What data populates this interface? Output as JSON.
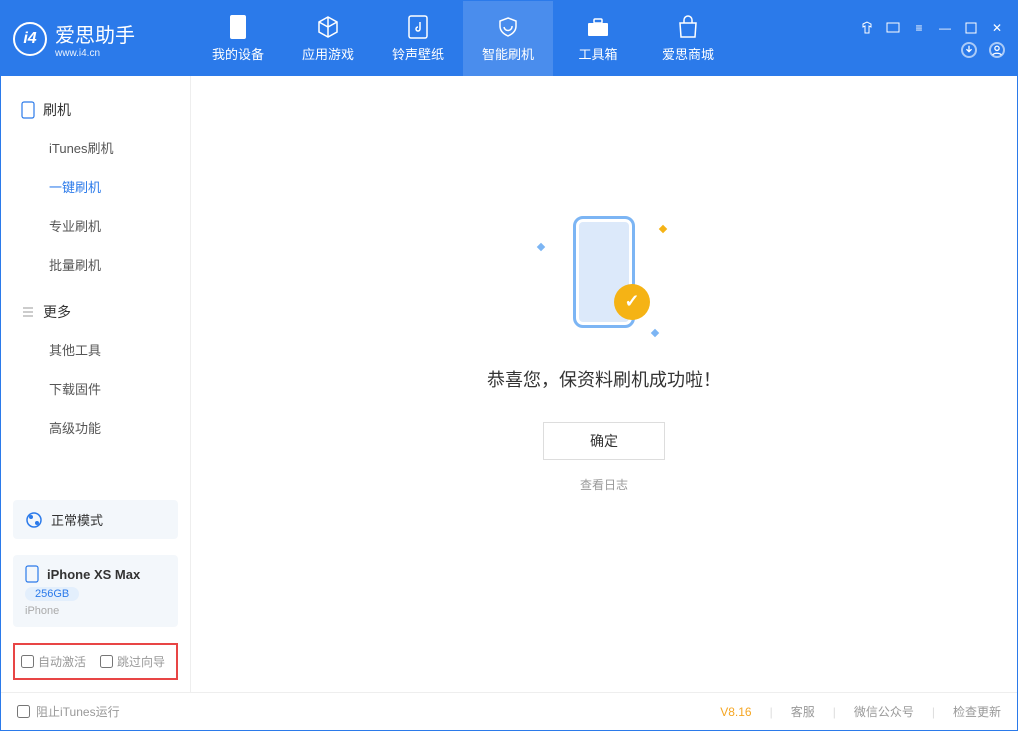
{
  "app": {
    "name_cn": "爱思助手",
    "name_en": "www.i4.cn"
  },
  "tabs": [
    {
      "label": "我的设备"
    },
    {
      "label": "应用游戏"
    },
    {
      "label": "铃声壁纸"
    },
    {
      "label": "智能刷机"
    },
    {
      "label": "工具箱"
    },
    {
      "label": "爱思商城"
    }
  ],
  "sidebar": {
    "group1": "刷机",
    "items1": [
      "iTunes刷机",
      "一键刷机",
      "专业刷机",
      "批量刷机"
    ],
    "group2": "更多",
    "items2": [
      "其他工具",
      "下载固件",
      "高级功能"
    ]
  },
  "mode": {
    "label": "正常模式"
  },
  "device": {
    "name": "iPhone XS Max",
    "capacity": "256GB",
    "type": "iPhone"
  },
  "opts": {
    "auto_activate": "自动激活",
    "skip_guide": "跳过向导"
  },
  "main": {
    "message": "恭喜您，保资料刷机成功啦！",
    "ok": "确定",
    "log": "查看日志"
  },
  "footer": {
    "block_itunes": "阻止iTunes运行",
    "version": "V8.16",
    "support": "客服",
    "wechat": "微信公众号",
    "update": "检查更新"
  }
}
